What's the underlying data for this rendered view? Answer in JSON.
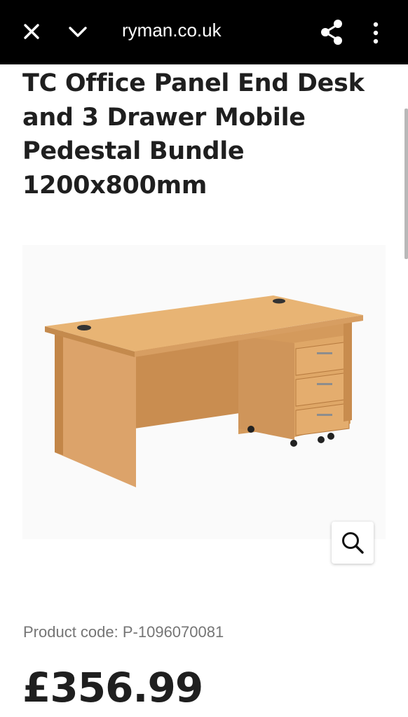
{
  "browser": {
    "url": "ryman.co.uk",
    "icons": {
      "close": "close-icon",
      "collapse": "chevron-down-icon",
      "share": "share-icon",
      "menu": "more-vertical-icon"
    }
  },
  "product": {
    "title": "TC Office Panel End Desk and 3 Drawer Mobile Pedestal Bundle 1200x800mm",
    "product_code": "Product code: P-1096070081",
    "price": "£356.99",
    "zoom_icon": "search-icon"
  },
  "colors": {
    "topbar": "#000000",
    "wood_top": "#e8b26e",
    "wood_side": "#d9a060",
    "wood_panel": "#c88c4e"
  }
}
